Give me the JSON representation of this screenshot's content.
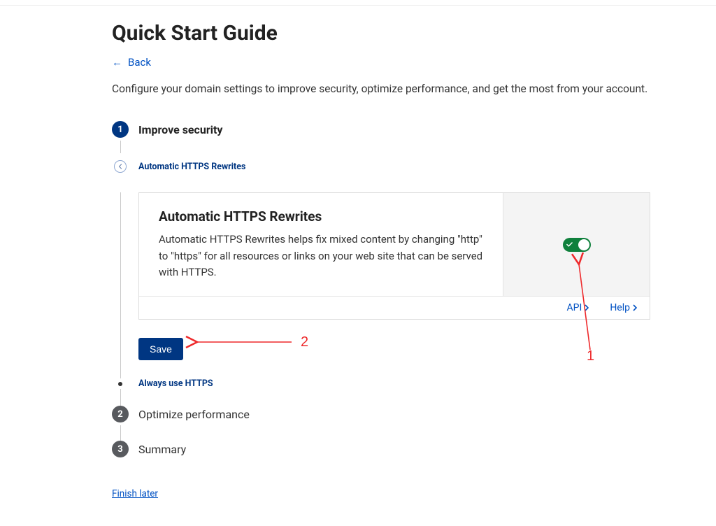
{
  "header": {
    "title": "Quick Start Guide",
    "back_label": "Back",
    "description": "Configure your domain settings to improve security, optimize performance, and get the most from your account."
  },
  "steps": {
    "s1": {
      "num": "1",
      "title": "Improve security"
    },
    "s1_sub1": {
      "label": "Automatic HTTPS Rewrites"
    },
    "s1_sub2": {
      "label": "Always use HTTPS"
    },
    "s2": {
      "num": "2",
      "title": "Optimize performance"
    },
    "s3": {
      "num": "3",
      "title": "Summary"
    }
  },
  "card": {
    "title": "Automatic HTTPS Rewrites",
    "desc": "Automatic HTTPS Rewrites helps fix mixed content by changing \"http\" to \"https\" for all resources or links on your web site that can be served with HTTPS.",
    "api_label": "API",
    "help_label": "Help",
    "toggle_on": true
  },
  "actions": {
    "save_label": "Save",
    "finish_label": "Finish later"
  },
  "annotations": {
    "a1": "1",
    "a2": "2"
  }
}
